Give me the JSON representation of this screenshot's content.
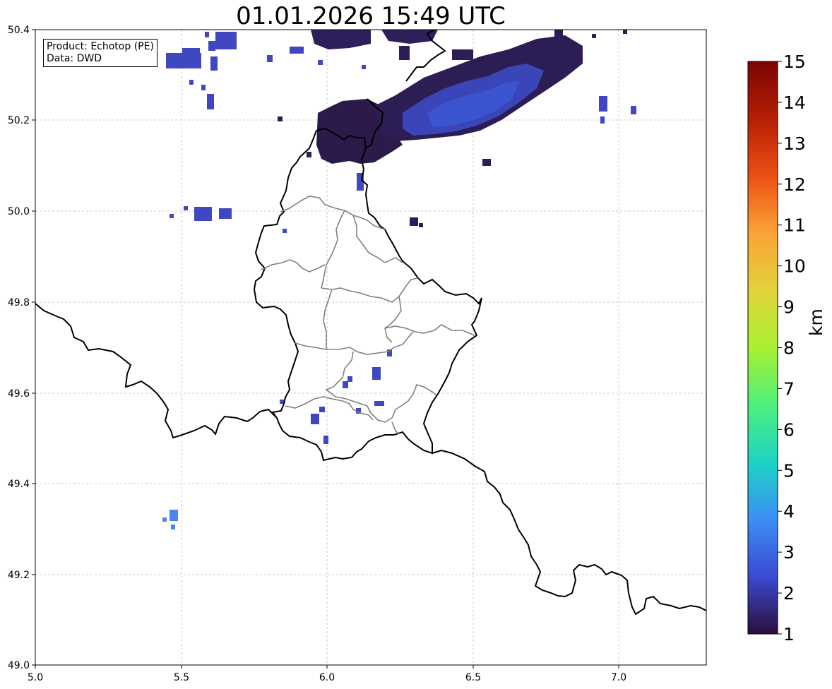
{
  "title": "01.01.2026 15:49 UTC",
  "info": {
    "product": "Product: Echotop (PE)",
    "data": "Data: DWD"
  },
  "axes": {
    "x_ticks": [
      "5.0",
      "5.5",
      "6.0",
      "6.5",
      "7.0"
    ],
    "y_ticks": [
      "49.0",
      "49.2",
      "49.4",
      "49.6",
      "49.8",
      "50.0",
      "50.2",
      "50.4"
    ],
    "lon_range": [
      5.0,
      7.3
    ],
    "lat_range": [
      49.0,
      50.4
    ],
    "grid": true
  },
  "colorbar": {
    "unit": "km",
    "ticks": [
      "1",
      "2",
      "3",
      "4",
      "5",
      "6",
      "7",
      "8",
      "9",
      "10",
      "11",
      "12",
      "13",
      "14",
      "15"
    ],
    "range": [
      1,
      15
    ],
    "colormap": "turbo",
    "colors": [
      "#2b0d3c",
      "#3a4ad0",
      "#3c8ef5",
      "#1dd4c4",
      "#4df07c",
      "#a8f032",
      "#e2d23a",
      "#fba336",
      "#ea5013",
      "#b51f04",
      "#7a0403"
    ]
  },
  "echo_areas": [
    {
      "region": "northern belt, east of 6.2",
      "echotop_km": "1–3"
    },
    {
      "region": "north of 50.1 near 6.0–6.2",
      "echotop_km": "1–2"
    },
    {
      "region": "near 5.47 / 49.33",
      "echotop_km": "3"
    }
  ]
}
